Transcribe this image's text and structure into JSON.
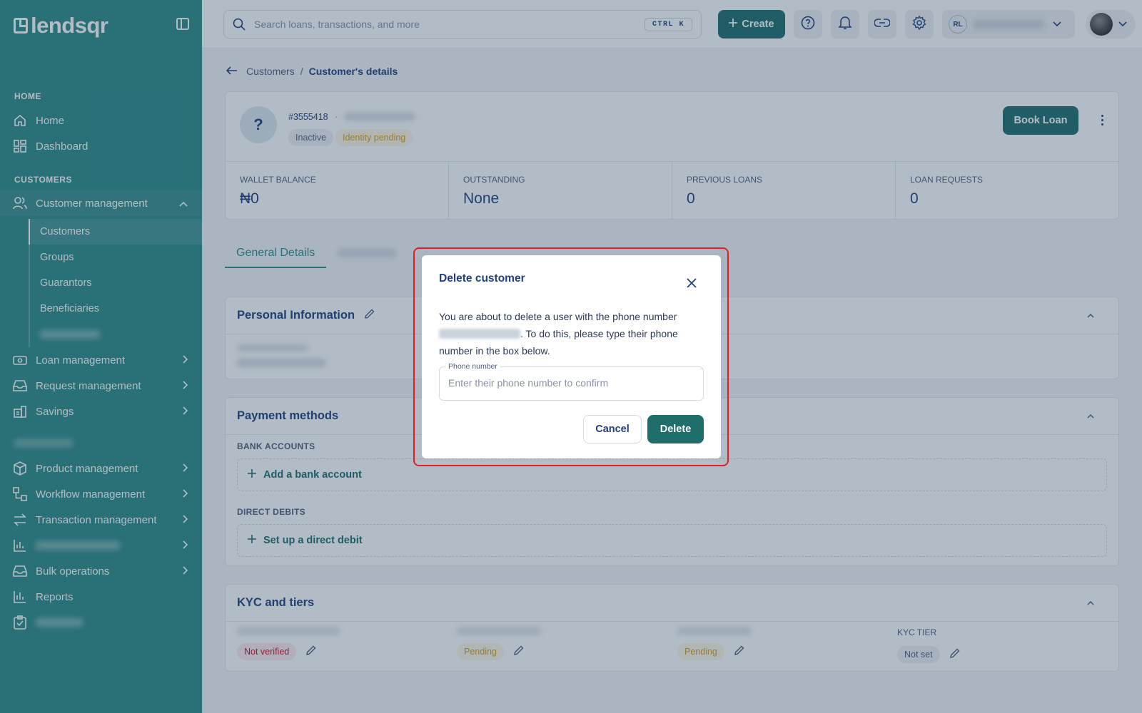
{
  "brand": {
    "name": "lendsqr"
  },
  "sidebar": {
    "sections": {
      "home": "HOME",
      "customers": "CUSTOMERS"
    },
    "home_items": [
      {
        "label": "Home"
      },
      {
        "label": "Dashboard"
      }
    ],
    "customer_management": {
      "label": "Customer management"
    },
    "customer_sub": [
      {
        "label": "Customers"
      },
      {
        "label": "Groups"
      },
      {
        "label": "Guarantors"
      },
      {
        "label": "Beneficiaries"
      }
    ],
    "items": [
      {
        "label": "Loan management"
      },
      {
        "label": "Request management"
      },
      {
        "label": "Savings"
      },
      {
        "label": "Product management"
      },
      {
        "label": "Workflow management"
      },
      {
        "label": "Transaction management"
      },
      {
        "label": "Bulk operations"
      },
      {
        "label": "Reports"
      }
    ]
  },
  "topbar": {
    "search_placeholder": "Search loans, transactions, and more",
    "shortcut": "CTRL K",
    "create_label": "Create",
    "org_initials": "RL"
  },
  "breadcrumb": {
    "parent": "Customers",
    "separator": "/",
    "current": "Customer's details"
  },
  "profile": {
    "avatar_text": "?",
    "customer_id": "#3555418",
    "dot": "·",
    "status_tags": [
      "Inactive",
      "Identity pending"
    ],
    "book_loan_label": "Book Loan"
  },
  "stats": [
    {
      "label": "WALLET BALANCE",
      "value": "₦0"
    },
    {
      "label": "OUTSTANDING",
      "value": "None"
    },
    {
      "label": "PREVIOUS LOANS",
      "value": "0"
    },
    {
      "label": "LOAN REQUESTS",
      "value": "0"
    }
  ],
  "tabs": [
    {
      "label": "General Details"
    }
  ],
  "personal_info": {
    "title": "Personal Information"
  },
  "payment_methods": {
    "title": "Payment methods",
    "bank_accounts_label": "BANK ACCOUNTS",
    "add_bank_label": "Add a bank account",
    "direct_debits_label": "DIRECT DEBITS",
    "setup_debit_label": "Set up a direct debit"
  },
  "kyc": {
    "title": "KYC and tiers",
    "columns": [
      {
        "label": "",
        "status": "Not verified",
        "tone": "red"
      },
      {
        "label": "",
        "status": "Pending",
        "tone": "amber"
      },
      {
        "label": "",
        "status": "Pending",
        "tone": "amber"
      },
      {
        "label": "KYC TIER",
        "status": "Not set",
        "tone": "grey"
      }
    ]
  },
  "modal": {
    "title": "Delete customer",
    "body_before": "You are about to delete a user with the phone number",
    "body_after": ". To do this, please type their phone number in the box below.",
    "field_label": "Phone number",
    "field_placeholder": "Enter their phone number to confirm",
    "field_value": "",
    "cancel_label": "Cancel",
    "delete_label": "Delete"
  },
  "colors": {
    "sidebar": "#2f8a86",
    "primary": "#1f6e6c",
    "highlight": "#e31e24",
    "text": "#213F7D"
  }
}
